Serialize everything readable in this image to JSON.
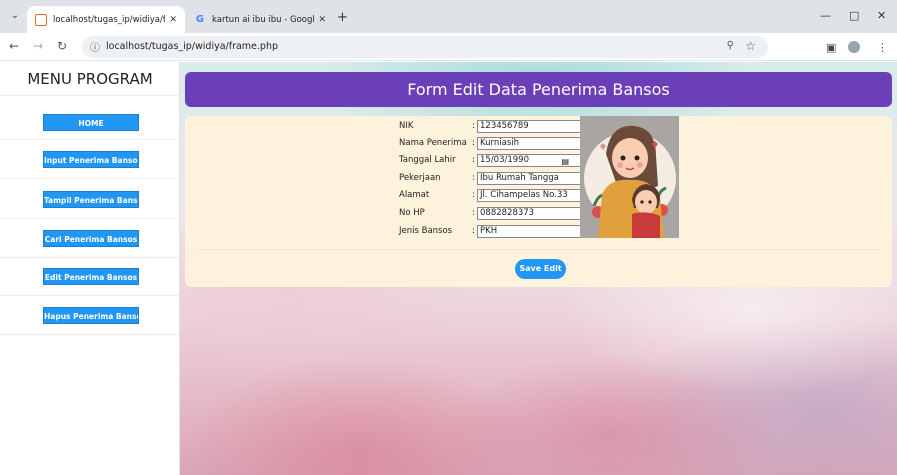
{
  "browser": {
    "tabs": [
      {
        "label": "localhost/tugas_ip/widiya/fram",
        "active": true
      },
      {
        "label": "kartun ai ibu ibu - Google Sear",
        "active": false
      }
    ],
    "url": "localhost/tugas_ip/widiya/frame.php"
  },
  "sidebar": {
    "title": "MENU PROGRAM",
    "items": [
      {
        "label": "HOME"
      },
      {
        "label": "Input Penerima Bansos"
      },
      {
        "label": "Tampil Penerima Bansos"
      },
      {
        "label": "Cari Penerima Bansos"
      },
      {
        "label": "Edit Penerima Bansos"
      },
      {
        "label": "Hapus Penerima Bansos"
      }
    ]
  },
  "form": {
    "title": "Form Edit Data Penerima Bansos",
    "fields": [
      {
        "label": "NIK",
        "value": "123456789"
      },
      {
        "label": "Nama Penerima",
        "value": "Kurniasih"
      },
      {
        "label": "Tanggal Lahir",
        "value": "15/03/1990"
      },
      {
        "label": "Pekerjaan",
        "value": "Ibu Rumah Tangga"
      },
      {
        "label": "Alamat",
        "value": "Jl. Cihampelas No.33"
      },
      {
        "label": "No HP",
        "value": "0882828373"
      },
      {
        "label": "Jenis Bansos",
        "value": "PKH"
      }
    ],
    "colon": ":",
    "save_label": "Save Edit"
  },
  "colors": {
    "header": "#6a3fb8",
    "button": "#2196f3",
    "card": "#fdf2dc"
  },
  "icons": [
    "chevron-down-icon",
    "close-icon",
    "google-icon",
    "plus-icon",
    "minimize-icon",
    "restore-icon",
    "back-icon",
    "forward-icon",
    "reload-icon",
    "site-info-icon",
    "zoom-icon",
    "star-icon",
    "sidepanel-icon",
    "profile-icon",
    "kebab-menu-icon",
    "calendar-icon"
  ]
}
